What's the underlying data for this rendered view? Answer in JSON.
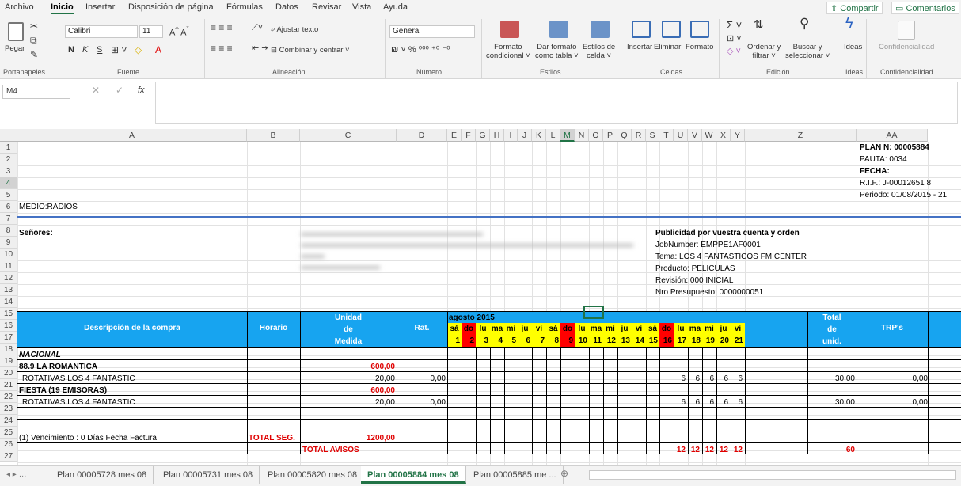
{
  "menu": [
    "Archivo",
    "Inicio",
    "Insertar",
    "Disposición de página",
    "Fórmulas",
    "Datos",
    "Revisar",
    "Vista",
    "Ayuda"
  ],
  "share_label": "Compartir",
  "comments_label": "Comentarios",
  "ribbon": {
    "paste": "Pegar",
    "font_name": "Calibri",
    "font_size": "11",
    "bold": "N",
    "italic": "K",
    "underline": "S",
    "wrap_text": "Ajustar texto",
    "merge_center": "Combinar y centrar",
    "number_format": "General",
    "cond_format": "Formato",
    "cond_format2": "condicional",
    "as_table": "Dar formato",
    "as_table2": "como tabla",
    "cell_styles": "Estilos de",
    "cell_styles2": "celda",
    "insert": "Insertar",
    "delete": "Eliminar",
    "format": "Formato",
    "sort": "Ordenar y",
    "sort2": "filtrar",
    "find": "Buscar y",
    "find2": "seleccionar",
    "ideas": "Ideas",
    "confidentiality": "Confidencialidad",
    "groups": [
      "Portapapeles",
      "Fuente",
      "Alineación",
      "Número",
      "Estilos",
      "Celdas",
      "Edición",
      "Ideas",
      "Confidencialidad"
    ]
  },
  "namebox": "M4",
  "fx": "fx",
  "columns": [
    "A",
    "B",
    "C",
    "D",
    "E",
    "F",
    "G",
    "H",
    "I",
    "J",
    "K",
    "L",
    "M",
    "N",
    "O",
    "P",
    "Q",
    "R",
    "S",
    "T",
    "U",
    "V",
    "W",
    "X",
    "Y",
    "Z",
    "AA"
  ],
  "rows": [
    "1",
    "2",
    "3",
    "4",
    "5",
    "6",
    "7",
    "8",
    "9",
    "10",
    "11",
    "12",
    "13",
    "14",
    "15",
    "16",
    "17",
    "18",
    "19",
    "20",
    "21",
    "22",
    "23",
    "24",
    "25",
    "26",
    "27"
  ],
  "header_info": {
    "plan": "PLAN N: 00005884",
    "pauta": "PAUTA: 0034",
    "fecha": "FECHA:",
    "rif": "R.I.F.: J-00012651 8",
    "periodo": "Periodo: 01/08/2015  -  21"
  },
  "medio": "MEDIO:RADIOS",
  "senores": "Señores:",
  "pub": {
    "title": "Publicidad por vuestra cuenta y orden",
    "job": "JobNumber: EMPPE1AF0001",
    "tema": "Tema: LOS 4 FANTASTICOS FM CENTER",
    "producto": "Producto: PELICULAS",
    "revision": "Revisión: 000 INICIAL",
    "presupuesto": "Nro Presupuesto: 0000000051"
  },
  "table_header": {
    "desc": "Descripción de la compra",
    "horario": "Horario",
    "unidad1": "Unidad",
    "unidad2": "de",
    "unidad3": "Medida",
    "rat": "Rat.",
    "month": "agosto 2015",
    "total1": "Total",
    "total2": "de",
    "total3": "unid.",
    "trp": "TRP's"
  },
  "days": [
    {
      "d": "sá",
      "n": "1",
      "t": "we"
    },
    {
      "d": "do",
      "n": "2",
      "t": "su"
    },
    {
      "d": "lu",
      "n": "3",
      "t": ""
    },
    {
      "d": "ma",
      "n": "4",
      "t": ""
    },
    {
      "d": "mi",
      "n": "5",
      "t": ""
    },
    {
      "d": "ju",
      "n": "6",
      "t": ""
    },
    {
      "d": "vi",
      "n": "7",
      "t": ""
    },
    {
      "d": "sá",
      "n": "8",
      "t": ""
    },
    {
      "d": "do",
      "n": "9",
      "t": "su"
    },
    {
      "d": "lu",
      "n": "10",
      "t": ""
    },
    {
      "d": "ma",
      "n": "11",
      "t": ""
    },
    {
      "d": "mi",
      "n": "12",
      "t": ""
    },
    {
      "d": "ju",
      "n": "13",
      "t": ""
    },
    {
      "d": "vi",
      "n": "14",
      "t": ""
    },
    {
      "d": "sá",
      "n": "15",
      "t": ""
    },
    {
      "d": "do",
      "n": "16",
      "t": "su"
    },
    {
      "d": "lu",
      "n": "17",
      "t": ""
    },
    {
      "d": "ma",
      "n": "18",
      "t": ""
    },
    {
      "d": "mi",
      "n": "19",
      "t": ""
    },
    {
      "d": "ju",
      "n": "20",
      "t": ""
    },
    {
      "d": "vi",
      "n": "21",
      "t": "we"
    }
  ],
  "body": {
    "nacional": "NACIONAL",
    "station1": "88.9  LA ROMANTICA",
    "station1_total": "600,00",
    "item1": "ROTATIVAS LOS 4 FANTASTIC",
    "item1_unit": "20,00",
    "item1_rat": "0,00",
    "item1_days": [
      "6",
      "6",
      "6",
      "6",
      "6"
    ],
    "item1_total": "30,00",
    "item1_trp": "0,00",
    "station2": "FIESTA (19 EMISORAS)",
    "station2_total": "600,00",
    "item2": "ROTATIVAS LOS 4 FANTASTIC",
    "item2_unit": "20,00",
    "item2_rat": "0,00",
    "item2_days": [
      "6",
      "6",
      "6",
      "6",
      "6"
    ],
    "item2_total": "30,00",
    "item2_trp": "0,00",
    "vencimiento": "(1) Vencimiento : 0 Días Fecha Factura",
    "total_seg": "TOTAL SEG.",
    "total_seg_val": "1200,00",
    "total_avisos": "TOTAL AVISOS",
    "avisos_days": [
      "12",
      "12",
      "12",
      "12",
      "12"
    ],
    "avisos_total": "60"
  },
  "sheets": [
    "Plan 00005728 mes 08",
    "Plan 00005731 mes 08",
    "Plan 00005820 mes 08",
    "Plan 00005884 mes 08",
    "Plan 00005885 me ..."
  ],
  "active_sheet": "Plan 00005884 mes 08"
}
